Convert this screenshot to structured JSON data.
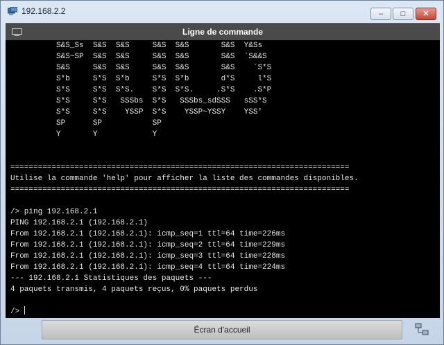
{
  "window": {
    "title": "192.168.2.2",
    "icon": "network-app-icon"
  },
  "window_controls": {
    "minimize": "–",
    "maximize": "□",
    "close": "✕"
  },
  "header": {
    "title": "Ligne de commande",
    "icon": "monitor-icon"
  },
  "console": {
    "lines": [
      "          S&S_Ss  S&S  S&S     S&S  S&S       S&S  Y&Ss",
      "          S&S~SP  S&S  S&S     S&S  S&S       S&S  `S&&S",
      "          S&S     S&S  S&S     S&S  S&S       S&S    `S*S",
      "          S*b     S*S  S*b     S*S  S*b       d*S     l*S",
      "          S*S     S*S  S*S.    S*S  S*S.     .S*S    .S*P",
      "          S*S     S*S   SSSbs  S*S   SSSbs_sdSSS   sSS*S",
      "          S*S     S*S    YSSP  S*S    YSSP~YSSY    YSS'",
      "          SP      SP           SP",
      "          Y       Y            Y",
      "",
      "",
      "==========================================================================",
      "Utilise la commande 'help' pour afficher la liste des commandes disponibles.",
      "==========================================================================",
      "",
      "/> ping 192.168.2.1",
      "PING 192.168.2.1 (192.168.2.1)",
      "From 192.168.2.1 (192.168.2.1): icmp_seq=1 ttl=64 time=226ms",
      "From 192.168.2.1 (192.168.2.1): icmp_seq=2 ttl=64 time=229ms",
      "From 192.168.2.1 (192.168.2.1): icmp_seq=3 ttl=64 time=228ms",
      "From 192.168.2.1 (192.168.2.1): icmp_seq=4 ttl=64 time=224ms",
      "--- 192.168.2.1 Statistiques des paquets ---",
      "4 paquets transmis, 4 paquets reçus, 0% paquets perdus",
      ""
    ],
    "prompt": "/> "
  },
  "footer": {
    "home_button": "Écran d'accueil",
    "icon": "network-topology-icon"
  }
}
